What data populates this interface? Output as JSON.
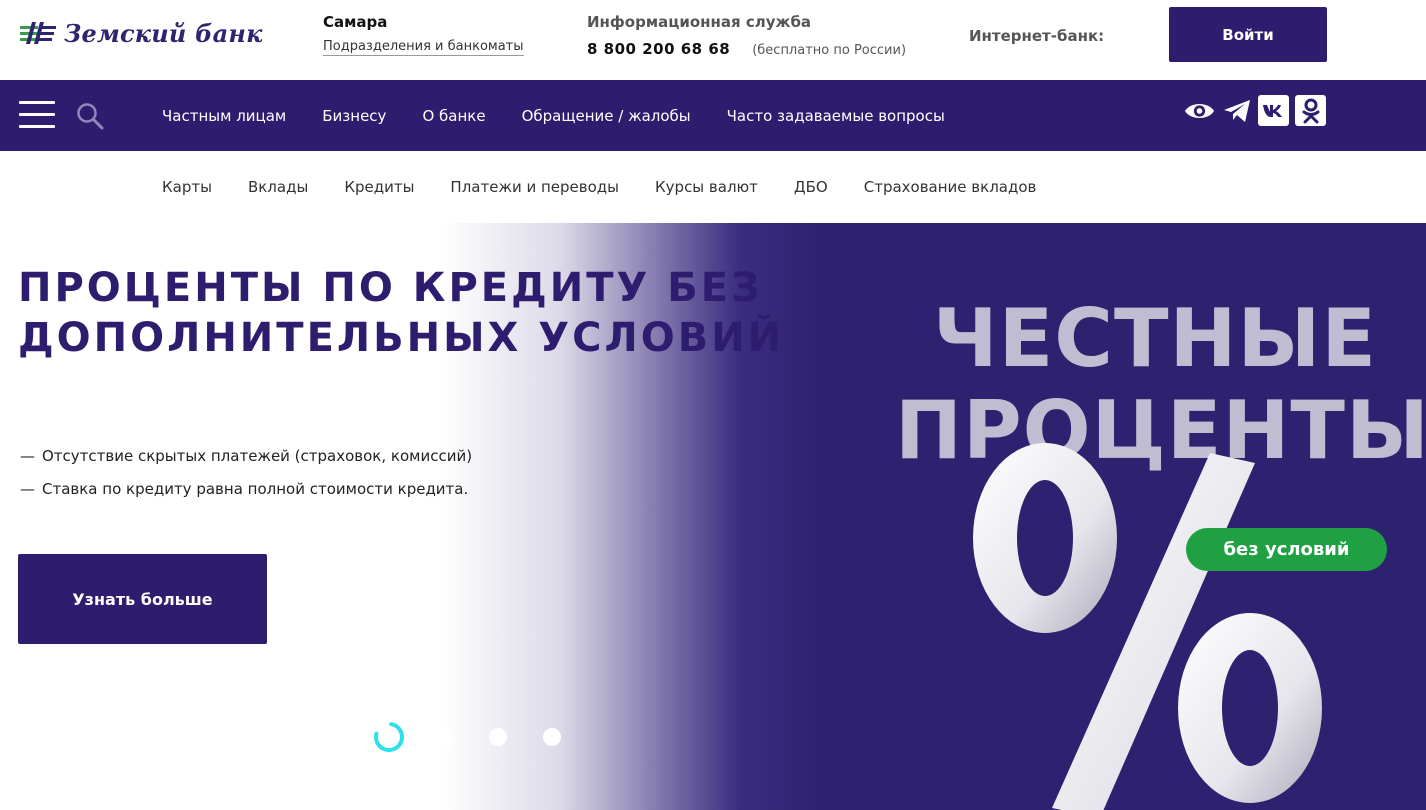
{
  "header": {
    "logo_text": "Земский банк",
    "city": "Самара",
    "branches_link": "Подразделения и банкоматы",
    "info_title": "Информационная служба",
    "phone": "8 800 200 68 68",
    "phone_note": "(бесплатно по России)",
    "internet_bank_label": "Интернет-банк:",
    "login_label": "Войти"
  },
  "main_nav": {
    "items": [
      "Частным лицам",
      "Бизнесу",
      "О банке",
      "Обращение / жалобы",
      "Часто задаваемые вопросы"
    ],
    "icons": [
      "menu-icon",
      "search-icon",
      "eye-icon",
      "telegram-icon",
      "vk-icon",
      "odnoklassniki-icon"
    ]
  },
  "sub_nav": {
    "items": [
      "Карты",
      "Вклады",
      "Кредиты",
      "Платежи и переводы",
      "Курсы валют",
      "ДБО",
      "Страхование вкладов"
    ]
  },
  "hero": {
    "title": "ПРОЦЕНТЫ ПО КРЕДИТУ БЕЗ ДОПОЛНИТЕЛЬНЫХ УСЛОВИЙ",
    "bullets": [
      "Отсутствие скрытых платежей (страховок, комиссий)",
      "Ставка по кредиту равна полной стоимости кредита."
    ],
    "button_label": "Узнать больше",
    "promo_line1": "ЧЕСТНЫЕ",
    "promo_line2": "ПРОЦЕНТЫ",
    "badge": "без условий",
    "slides_count": 4,
    "active_slide": 1
  },
  "colors": {
    "brand": "#2e1d6e",
    "badge_green": "#1fa043",
    "loader_cyan": "#2ee0ea"
  }
}
